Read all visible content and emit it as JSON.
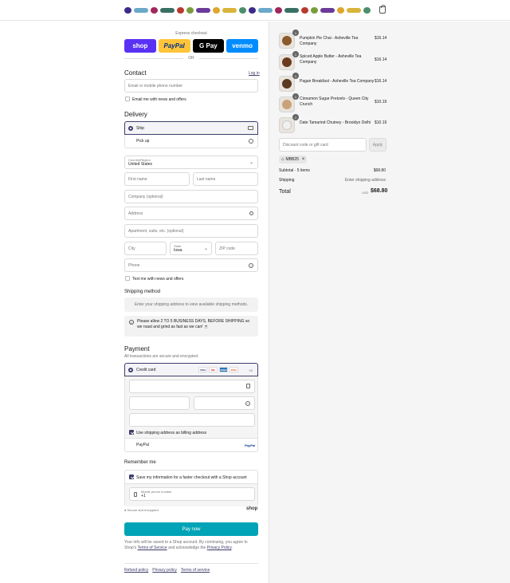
{
  "header": {
    "cart_icon": "bag-icon",
    "garnish_colors": [
      "#3d2a8a",
      "#6aa9c9",
      "#a0265c",
      "#3a6f64",
      "#b83a2f",
      "#7a9c3d",
      "#6b3b9a",
      "#e0a52b",
      "#d8b43a",
      "#4b8f6c",
      "#3d2a8a",
      "#6aa9c9",
      "#a0265c",
      "#3a6f64",
      "#b83a2f",
      "#7a9c3d",
      "#6b3b9a",
      "#e0a52b",
      "#d8b43a",
      "#4b8f6c"
    ]
  },
  "express": {
    "label": "Express checkout",
    "buttons": [
      {
        "label": "shop",
        "bg": "#5a31f4",
        "fg": "#ffffff"
      },
      {
        "label": "PayPal",
        "bg": "#ffc439",
        "fg": "#003087"
      },
      {
        "label": "G Pay",
        "bg": "#000000",
        "fg": "#ffffff"
      },
      {
        "label": "venmo",
        "bg": "#008cff",
        "fg": "#ffffff"
      }
    ],
    "or": "OR"
  },
  "contact": {
    "title": "Contact",
    "login": "Log in",
    "email_placeholder": "Email or mobile phone number",
    "news_label": "Email me with news and offers"
  },
  "delivery": {
    "title": "Delivery",
    "options": [
      {
        "label": "Ship",
        "icon": "truck-icon",
        "selected": true
      },
      {
        "label": "Pick up",
        "icon": "store-icon",
        "selected": false
      }
    ],
    "country_label": "Country/Region",
    "country_value": "United States",
    "first_name": "First name",
    "last_name": "Last name",
    "company": "Company (optional)",
    "address": "Address",
    "apartment": "Apartment, suite, etc. (optional)",
    "city": "City",
    "state_label": "State",
    "state_value": "Iowa",
    "zip": "ZIP code",
    "phone": "Phone",
    "text_news": "Text me with news and offers"
  },
  "shipping": {
    "title": "Shipping method",
    "info": "Enter your shipping address to view available shipping methods.",
    "notice": "Please allow 2 TO 5 BUSINESS DAYS, BEFORE SHIPPING so we roast and grind as fast as we can! ☕"
  },
  "payment": {
    "title": "Payment",
    "subtitle": "All transactions are secure and encrypted.",
    "credit_card": "Credit card",
    "cards": [
      {
        "label": "VISA",
        "bg": "#ffffff",
        "fg": "#1a1f71"
      },
      {
        "label": "MC",
        "bg": "#ffffff",
        "fg": "#eb001b"
      },
      {
        "label": "AMEX",
        "bg": "#2e77bb",
        "fg": "#ffffff"
      },
      {
        "label": "DISC",
        "bg": "#ffffff",
        "fg": "#e55c20"
      }
    ],
    "more_cards": "+3",
    "billing_same": "Use shipping address as billing address",
    "paypal": "PayPal",
    "paypal_logo": "PayPal"
  },
  "remember": {
    "title": "Remember me",
    "save_info": "Save my information for a faster checkout with a Shop account",
    "mobile_label": "Mobile phone number",
    "mobile_value": "+1",
    "secure": "Secure and encrypted",
    "shop_logo": "shop"
  },
  "pay_button": "Pay now",
  "legal": {
    "text1": "Your info will be saved to a Shop account. By continuing, you agree to Shop's",
    "terms": "Terms of Service",
    "text2": "and acknowledge the",
    "privacy": "Privacy Policy",
    "text3": "."
  },
  "footer": {
    "links": [
      "Refund policy",
      "Privacy policy",
      "Terms of service"
    ]
  },
  "summary": {
    "items": [
      {
        "name": "Pumpkin Pie Chai - Asheville Tea Company",
        "price": "$16.14",
        "qty": "1",
        "color": "#8a5a2b"
      },
      {
        "name": "Spiced Apple Butter - Asheville Tea Company",
        "price": "$16.14",
        "qty": "1",
        "color": "#6b3a1e"
      },
      {
        "name": "Pagan Breakfast - Asheville Tea Company",
        "price": "$16.14",
        "qty": "1",
        "color": "#5a3a22"
      },
      {
        "name": "Cinnamon Sugar Pretzels - Queen City Crunch",
        "price": "$10.19",
        "qty": "1",
        "color": "#c9a27a"
      },
      {
        "name": "Date Tamarind Chutney - Brooklyn Delhi",
        "price": "$10.19",
        "qty": "1",
        "color": "#f0f0f0"
      }
    ],
    "discount_placeholder": "Discount code or gift card",
    "apply": "Apply",
    "code": "MBB25",
    "subtotal_label": "Subtotal · 5 items",
    "subtotal_value": "$68.80",
    "shipping_label": "Shipping",
    "shipping_value": "Enter shipping address",
    "total_label": "Total",
    "currency": "USD",
    "total_value": "$68.80"
  }
}
